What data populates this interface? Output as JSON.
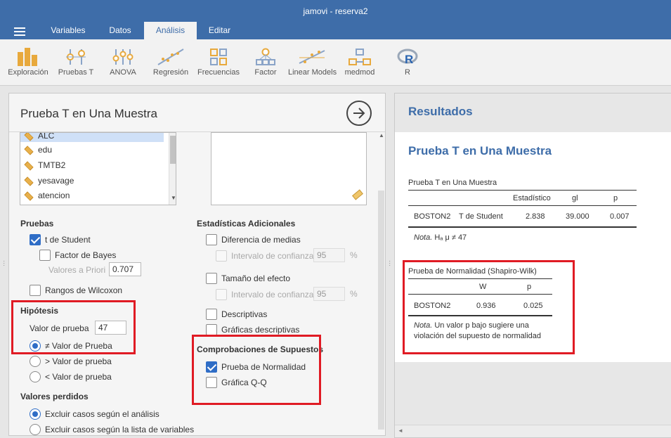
{
  "window": {
    "title": "jamovi - reserva2"
  },
  "menu_tabs": [
    {
      "label": "Variables"
    },
    {
      "label": "Datos"
    },
    {
      "label": "Análisis"
    },
    {
      "label": "Editar"
    }
  ],
  "ribbon": [
    {
      "label": "Exploración",
      "icon": "bar-chart-icon"
    },
    {
      "label": "Pruebas T",
      "icon": "t-test-icon"
    },
    {
      "label": "ANOVA",
      "icon": "anova-icon"
    },
    {
      "label": "Regresión",
      "icon": "regression-icon"
    },
    {
      "label": "Frecuencias",
      "icon": "frequencies-icon"
    },
    {
      "label": "Factor",
      "icon": "factor-icon"
    },
    {
      "label": "Linear Models",
      "icon": "linear-models-icon"
    },
    {
      "label": "medmod",
      "icon": "medmod-icon"
    },
    {
      "label": "R",
      "icon": "r-icon"
    }
  ],
  "options": {
    "title": "Prueba T en Una Muestra",
    "variables": [
      {
        "name": "ALC"
      },
      {
        "name": "edu"
      },
      {
        "name": "TMTB2"
      },
      {
        "name": "yesavage"
      },
      {
        "name": "atencion"
      }
    ],
    "pruebas": {
      "heading": "Pruebas",
      "student": {
        "label": "t de Student",
        "checked": true
      },
      "bayes": {
        "label": "Factor de Bayes",
        "checked": false
      },
      "prior_label": "Valores a Priori",
      "prior_value": "0.707",
      "wilcoxon": {
        "label": "Rangos de Wilcoxon",
        "checked": false
      }
    },
    "hipotesis": {
      "heading": "Hipótesis",
      "test_value_label": "Valor de prueba",
      "test_value": "47",
      "options": [
        {
          "label": "≠ Valor de Prueba",
          "selected": true
        },
        {
          "label": "> Valor de prueba",
          "selected": false
        },
        {
          "label": "< Valor de prueba",
          "selected": false
        }
      ]
    },
    "perdidos": {
      "heading": "Valores perdidos",
      "options": [
        {
          "label": "Excluir casos según el análisis",
          "selected": true
        },
        {
          "label": "Excluir casos según la lista de variables",
          "selected": false
        }
      ]
    },
    "adicionales": {
      "heading": "Estadísticas Adicionales",
      "mean_diff": {
        "label": "Diferencia de medias",
        "checked": false
      },
      "ci_label": "Intervalo de confianza",
      "ci_value": "95",
      "ci_unit": "%",
      "effect": {
        "label": "Tamaño del efecto",
        "checked": false
      },
      "ci2_label": "Intervalo de confianza",
      "ci2_value": "95",
      "ci2_unit": "%",
      "desc": {
        "label": "Descriptivas",
        "checked": false
      },
      "plots": {
        "label": "Gráficas descriptivas",
        "checked": false
      }
    },
    "supuestos": {
      "heading": "Comprobaciones de Supuestos",
      "normality": {
        "label": "Prueba de Normalidad",
        "checked": true
      },
      "qq": {
        "label": "Gráfica Q-Q",
        "checked": false
      }
    }
  },
  "results": {
    "heading": "Resultados",
    "title": "Prueba T en Una Muestra",
    "ttest_table": {
      "caption": "Prueba T en Una Muestra",
      "headers": [
        "Estadístico",
        "gl",
        "p"
      ],
      "row": {
        "variable": "BOSTON2",
        "test": "T de Student",
        "stat": "2.838",
        "df": "39.000",
        "p": "0.007"
      },
      "note_label": "Nota.",
      "note_text": "Hₐ μ ≠ 47"
    },
    "normality_table": {
      "caption": "Prueba de Normalidad (Shapiro-Wilk)",
      "headers": [
        "W",
        "p"
      ],
      "row": {
        "variable": "BOSTON2",
        "w": "0.936",
        "p": "0.025"
      },
      "note_label": "Nota.",
      "note_line1": "Un valor p bajo sugiere una",
      "note_line2": "violación del supuesto de normalidad"
    }
  },
  "colors": {
    "brand": "#3e6da9",
    "highlight": "#e01b24",
    "checkbox": "#2f6dc6",
    "ribbon_icon": "#e8a93c"
  }
}
